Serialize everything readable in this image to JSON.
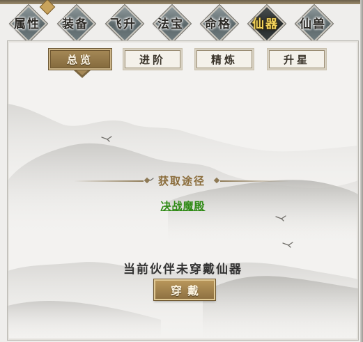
{
  "category_tabs": [
    {
      "label": "属性",
      "active": false
    },
    {
      "label": "装备",
      "active": false
    },
    {
      "label": "飞升",
      "active": false
    },
    {
      "label": "法宝",
      "active": false
    },
    {
      "label": "命格",
      "active": false
    },
    {
      "label": "仙器",
      "active": true
    },
    {
      "label": "仙兽",
      "active": false
    }
  ],
  "sub_tabs": [
    {
      "label": "总览",
      "active": true
    },
    {
      "label": "进阶",
      "active": false
    },
    {
      "label": "精炼",
      "active": false
    },
    {
      "label": "升星",
      "active": false
    }
  ],
  "acquire": {
    "title": "获取途径",
    "link": "决战魔殿"
  },
  "status": {
    "message": "当前伙伴未穿戴仙器",
    "equip_button": "穿戴"
  },
  "colors": {
    "accent_gold": "#a58856",
    "active_tab_text": "#f2d35b",
    "link_green": "#2f8a15"
  }
}
